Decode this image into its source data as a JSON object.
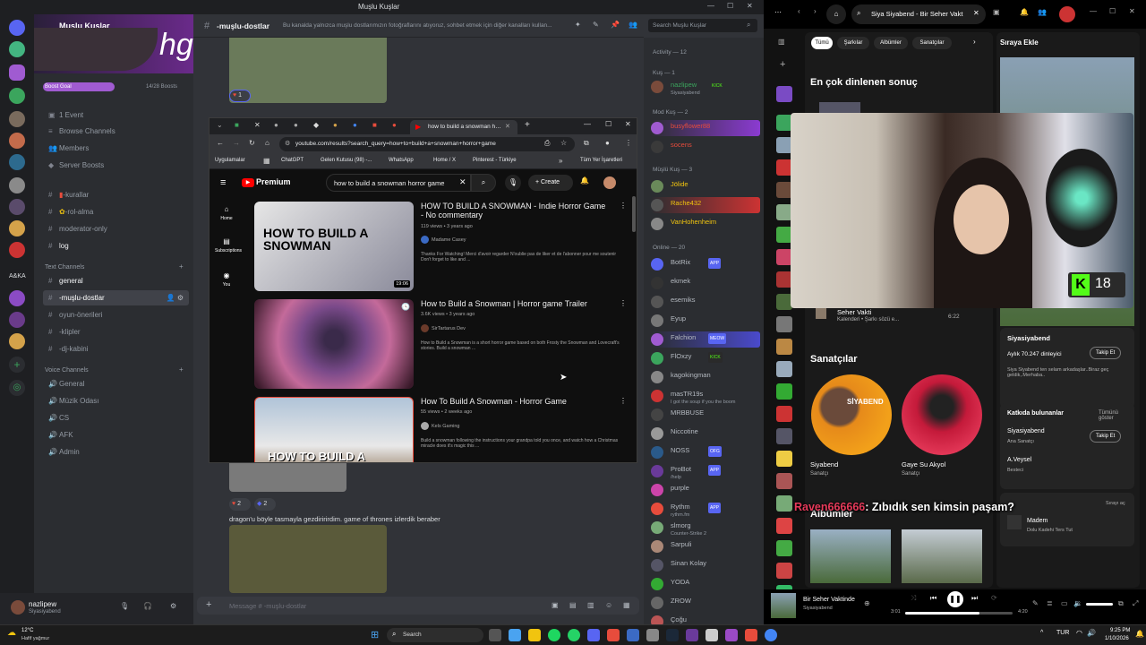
{
  "discord": {
    "window_title": "Muşlu Kuşlar",
    "server_name": "Muşlu Kuşlar",
    "boost_goal": "Boost Goal",
    "boost_count": "14/28 Boosts",
    "top_items": [
      "1 Event",
      "Browse Channels",
      "Members",
      "Server Boosts"
    ],
    "channels_top": [
      "-kurallar",
      "-rol-alma",
      "moderator-only",
      "log"
    ],
    "text_channels_label": "Text Channels",
    "text_channels": [
      "general",
      "-muşlu-dostlar",
      "oyun-önerileri",
      "-klipler",
      "-dj-kabini"
    ],
    "voice_channels_label": "Voice Channels",
    "voice_channels": [
      "General",
      "Müzik Odası",
      "CS",
      "AFK",
      "Admin"
    ],
    "user": {
      "name": "nazlipew",
      "status": "Siyasiyabend"
    },
    "chat_channel": "-muşlu-dostlar",
    "chat_topic": "Bu kanalda yalnızca muşlu dostlarımızın fotoğraflarını atıyoruz, sohbet etmek için diğer kanalları kullan...",
    "search_placeholder": "Search Muşlu Kuşlar",
    "reaction1": "1",
    "reaction2a": "2",
    "reaction2b": "2",
    "message": "dragon'u böyle tasmayla gezdiririrdim. game of thrones izlerdik beraber",
    "message_placeholder": "Message # -muşlu-dostlar",
    "members": {
      "activity_label": "Activity — 12",
      "kus1_label": "Kuş — 1",
      "kus1": [
        {
          "name": "nazlipew",
          "sub": "Siyasiyabend",
          "badge": "KICK"
        }
      ],
      "mod_label": "Mod Kuş — 2",
      "mods": [
        {
          "name": "busyflower88"
        },
        {
          "name": "socens"
        }
      ],
      "muslu_label": "Müşlü Kuş — 3",
      "muslu": [
        {
          "name": "Jölide"
        },
        {
          "name": "Rache432"
        },
        {
          "name": "VanHohenheim"
        }
      ],
      "online_label": "Online — 20",
      "online": [
        {
          "name": "BotRix",
          "badge": "APP"
        },
        {
          "name": "ekmek"
        },
        {
          "name": "esemiks"
        },
        {
          "name": "Eyup"
        },
        {
          "name": "Falchion",
          "badge": "MEOW"
        },
        {
          "name": "FlOxzy",
          "badge": "KICK"
        },
        {
          "name": "kagokingman"
        },
        {
          "name": "masTR19s",
          "sub": "I got the soup if you the boom"
        },
        {
          "name": "MRBBUSE"
        },
        {
          "name": "Niccotine"
        },
        {
          "name": "NOSS",
          "badge": "OFG"
        },
        {
          "name": "ProBot",
          "badge": "APP",
          "sub": "/help"
        },
        {
          "name": "purple"
        },
        {
          "name": "Rythm",
          "badge": "APP",
          "sub": "rythm.fm"
        },
        {
          "name": "slmorg",
          "sub": "Counter-Strike 2"
        },
        {
          "name": "Sarpuli"
        },
        {
          "name": "Sinan Kolay"
        },
        {
          "name": "YODA"
        },
        {
          "name": "ZROW"
        },
        {
          "name": "Çoğu"
        }
      ]
    }
  },
  "chrome": {
    "tab_title": "how to build a snowman horro",
    "url": "youtube.com/results?search_query=how+to+build+a+snowman+horror+game",
    "bookmarks": [
      "Uygulamalar",
      "ChatGPT",
      "Gelen Kutusu (98) -...",
      "WhatsApp",
      "Home / X",
      "Pinterest - Türkiye"
    ],
    "all_bookmarks": "Tüm Yer İşaretleri",
    "yt_logo": "Premium",
    "search_query": "how to build a snowman horror game",
    "create_label": "Create",
    "nav": [
      "Home",
      "Subscriptions",
      "You"
    ],
    "videos": [
      {
        "title": "HOW TO BUILD A SNOWMAN - Indie Horror Game - No commentary",
        "meta": "119 views • 3 years ago",
        "channel": "Madame Casey",
        "desc": "Thanks For Watching! Merci d'avoir regarder N'oublie pas de liker et de l'abonner pour me soutenir Don't forget to like and ...",
        "duration": "19:06",
        "thumb_text": "HOW TO BUILD A SNOWMAN"
      },
      {
        "title": "How to Build a Snowman | Horror game Trailer",
        "meta": "3.6K views • 3 years ago",
        "channel": "SirTartarus Dev",
        "desc": "How to Build a Snowman is a short horror game based on both Frosty the Snowman and Lovecraft's stories. Build a snowman ..."
      },
      {
        "title": "How To Build A Snowman - Horror Game",
        "meta": "55 views • 2 weeks ago",
        "channel": "Kels Gaming",
        "desc": "Build a snowman following the instructions your grandpa told you once, and watch how a Christmas miracle does it's magic this ...",
        "thumb_text": "HOW TO BUILD A"
      }
    ]
  },
  "spotify": {
    "search_value": "Siya Siyabend - Bir Seher Vakt",
    "filters": [
      "Tümü",
      "Şarkılar",
      "Albümler",
      "Sanatçılar"
    ],
    "top_result_label": "En çok dinlenen sonuç",
    "queue_label": "Sıraya Ekle",
    "song_row_title": "Seher Vakti",
    "song_row_sub": "Kalenderi • Şarkı sözü e...",
    "song_row_time": "6:22",
    "artists_label": "Sanatçılar",
    "artists": [
      {
        "name": "Siyabend",
        "role": "Sanatçı",
        "img_text": "SİYABEND"
      },
      {
        "name": "Gaye Su Akyol",
        "role": "Sanatçı"
      }
    ],
    "albums_label": "Albümler",
    "about_artist": "Siyasiyabend",
    "listeners": "Aylık 70.247 dinleyici",
    "follow": "Takip Et",
    "bio": "Siya Siyabend ten selam arkadaşlar..Biraz geç geldik,.Merhaba..",
    "contributors_label": "Katkıda bulunanlar",
    "show_all": "Tümünü göster",
    "contributors": [
      {
        "name": "Siyasiyabend",
        "role": "Ana Sanatçı"
      },
      {
        "name": "A.Veysel",
        "role": "Besteci"
      }
    ],
    "next_queue_label": "Sırayı aç",
    "next_song": "Madem",
    "next_song_sub": "Dolu Kadehi Ters Tut",
    "now_playing": "Bir Seher Vaktinde",
    "now_artist": "Siyasiyabend",
    "elapsed": "3:01",
    "duration": "4:20",
    "progress": 0.69,
    "cam_badge": "18",
    "chat_overlay_user": "Raven666666",
    "chat_overlay_text": ": Zıbıdık sen kimsin paşam?"
  },
  "taskbar": {
    "weather_temp": "12°C",
    "weather_desc": "Hafif yağmur",
    "search_label": "Search",
    "lang": "TUR",
    "time": "9:25 PM",
    "date": "1/10/2026"
  },
  "colors": {
    "discord_bg": "#313338",
    "spotify_green": "#1ed760",
    "yt_red": "#ff0000",
    "kick_green": "#53fc18"
  }
}
